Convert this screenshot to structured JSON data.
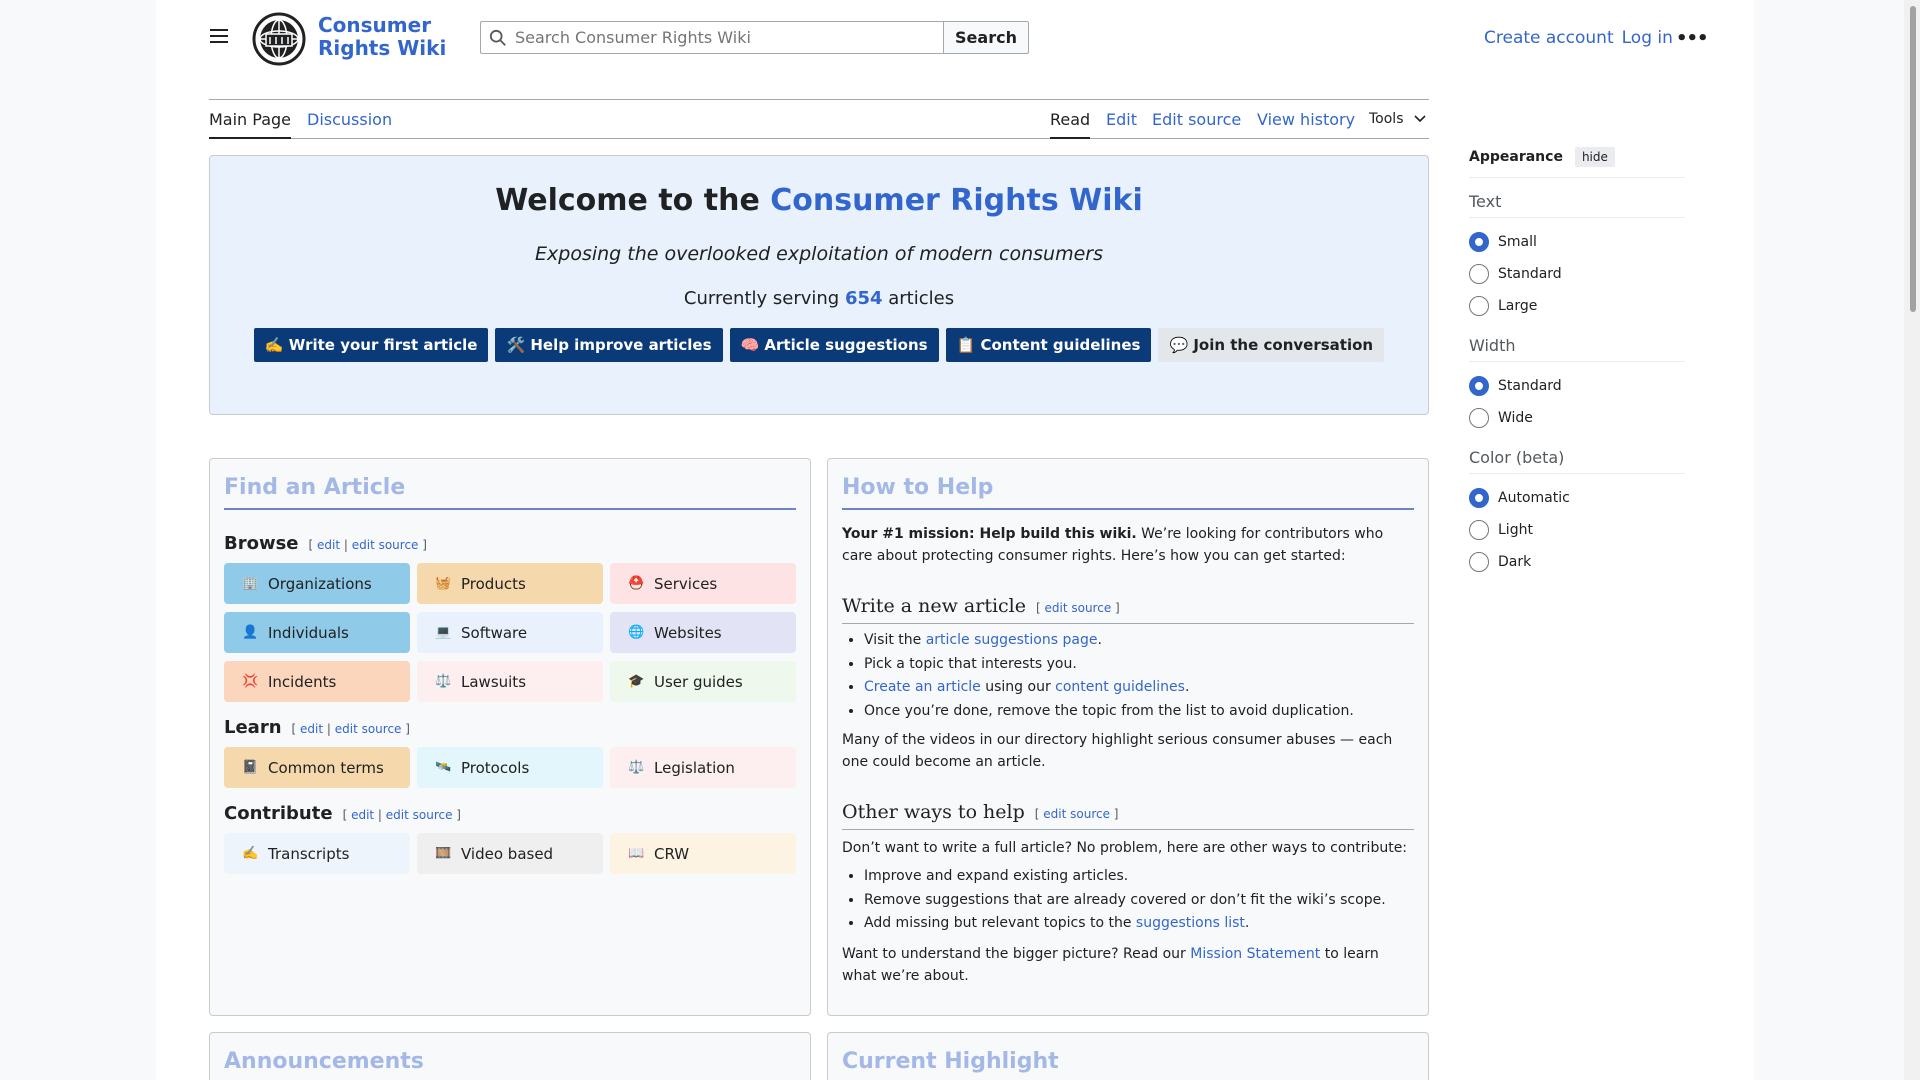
{
  "header": {
    "wordmark": "Consumer Rights Wiki",
    "search_placeholder": "Search Consumer Rights Wiki",
    "search_button": "Search",
    "create_account": "Create account",
    "log_in": "Log in"
  },
  "tabs": {
    "main_page": "Main Page",
    "discussion": "Discussion",
    "read": "Read",
    "edit": "Edit",
    "edit_source": "Edit source",
    "view_history": "View history",
    "tools": "Tools"
  },
  "appearance": {
    "title": "Appearance",
    "hide": "hide",
    "text_title": "Text",
    "text_options": [
      "Small",
      "Standard",
      "Large"
    ],
    "width_title": "Width",
    "width_options": [
      "Standard",
      "Wide"
    ],
    "color_title": "Color (beta)",
    "color_options": [
      "Automatic",
      "Light",
      "Dark"
    ]
  },
  "welcome": {
    "title_prefix": "Welcome to the ",
    "title_link": "Consumer Rights Wiki",
    "tagline": "Exposing the overlooked exploitation of modern consumers",
    "serving_prefix": "Currently serving ",
    "article_count": "654",
    "serving_suffix": " articles",
    "buttons": [
      "✍️ Write your first article",
      "🛠️ Help improve articles",
      "🧠 Article suggestions",
      "📋 Content guidelines",
      "💬 Join the conversation"
    ]
  },
  "find": {
    "title": "Find an Article",
    "browse": "Browse",
    "learn": "Learn",
    "contribute": "Contribute",
    "edit": "edit",
    "edit_source": "edit source",
    "browse_tiles": [
      {
        "icon": "🏢",
        "label": "Organizations",
        "color": "#8fcbe8"
      },
      {
        "icon": "🧺",
        "label": "Products",
        "color": "#f5d9ac"
      },
      {
        "icon": "⛑️",
        "label": "Services",
        "color": "#fde3e3"
      },
      {
        "icon": "👤",
        "label": "Individuals",
        "color": "#8fcbe8"
      },
      {
        "icon": "💻",
        "label": "Software",
        "color": "#e9f2fc"
      },
      {
        "icon": "🌐",
        "label": "Websites",
        "color": "#e3e3f6"
      },
      {
        "icon": "💢",
        "label": "Incidents",
        "color": "#fbd6bd"
      },
      {
        "icon": "⚖️",
        "label": "Lawsuits",
        "color": "#fdeef0"
      },
      {
        "icon": "🎓",
        "label": "User guides",
        "color": "#eef8ec"
      }
    ],
    "learn_tiles": [
      {
        "icon": "📓",
        "label": "Common terms",
        "color": "#f5d9ac"
      },
      {
        "icon": "🛰️",
        "label": "Protocols",
        "color": "#e3f6fb"
      },
      {
        "icon": "⚖️",
        "label": "Legislation",
        "color": "#fdeef0"
      }
    ],
    "contribute_tiles": [
      {
        "icon": "✍️",
        "label": "Transcripts",
        "color": "#eef4fb"
      },
      {
        "icon": "🎞️",
        "label": "Video based",
        "color": "#efefef"
      },
      {
        "icon": "📖",
        "label": "CRW",
        "color": "#fdf3e3"
      }
    ]
  },
  "help": {
    "title": "How to Help",
    "intro_bold": "Your #1 mission: Help build this wiki.",
    "intro_rest": " We’re looking for contributors who care about protecting consumer rights. Here’s how you can get started:",
    "write_title": "Write a new article",
    "edit_source": "edit source",
    "w1_pre": "Visit the ",
    "w1_link": "article suggestions page",
    "w1_post": ".",
    "w2": "Pick a topic that interests you.",
    "w3_link1": "Create an article",
    "w3_mid": " using our ",
    "w3_link2": "content guidelines",
    "w3_post": ".",
    "w4": "Once you’re done, remove the topic from the list to avoid duplication.",
    "videos_note": "Many of the videos in our directory highlight serious consumer abuses — each one could become an article.",
    "other_title": "Other ways to help",
    "other_intro": "Don’t want to write a full article? No problem, here are other ways to contribute:",
    "o1": "Improve and expand existing articles.",
    "o2": "Remove suggestions that are already covered or don’t fit the wiki’s scope.",
    "o3_pre": "Add missing but relevant topics to the ",
    "o3_link": "suggestions list",
    "o3_post": ".",
    "bigger_pre": "Want to understand the bigger picture? Read our ",
    "bigger_link": "Mission Statement",
    "bigger_post": " to learn what we’re about."
  },
  "announcements": {
    "title": "Announcements"
  },
  "highlight": {
    "title": "Current Highlight"
  }
}
